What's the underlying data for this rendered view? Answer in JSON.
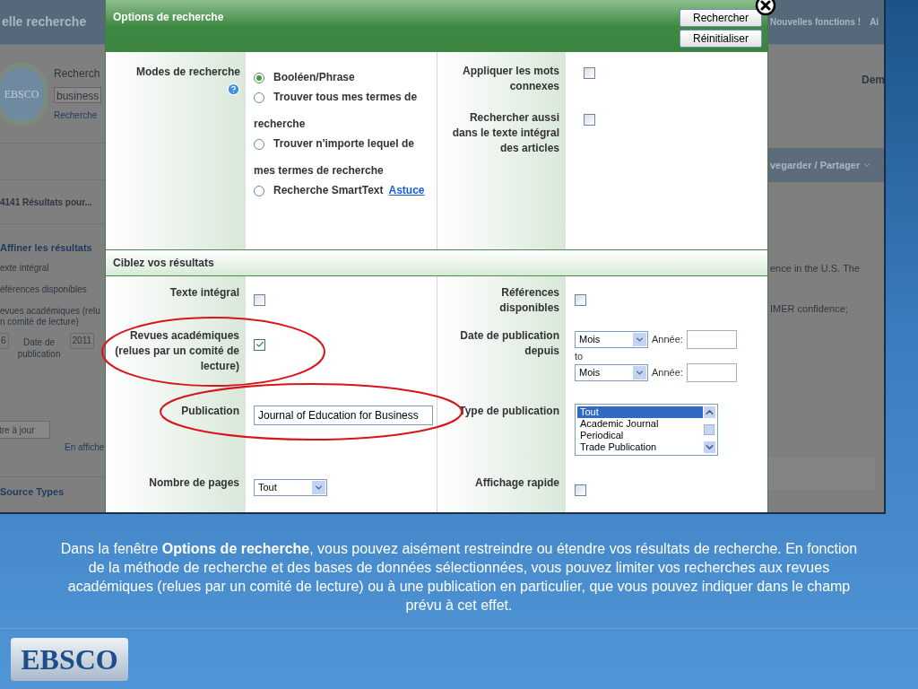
{
  "background_page": {
    "header_title": "elle recherche",
    "header_links": [
      "Nouvelles fonctions !",
      "Ai"
    ],
    "logo": "EBSCO",
    "search_label": "Recherch",
    "search_value": "business",
    "search_link": "Recherche",
    "right_label": "Dem",
    "results_count": "4141 Résultats pour...",
    "refine_title": "Affiner les résultats",
    "refine_lines": [
      "exte intégral",
      "éférences disponibles",
      "evues académiques (relu",
      "n comité de lecture)"
    ],
    "date_from": "6",
    "date_label": "Date de publication",
    "date_to": "2011",
    "update_button": "tre à jour",
    "show_link": "En affiche",
    "source_types": "Source Types",
    "share_menu": "vegarder / Partager",
    "snippets": [
      "ence in the U.S. The",
      "IMER confidence;"
    ]
  },
  "dialog": {
    "title": "Options de recherche",
    "buttons": [
      "Rechercher",
      "Réinitialiser"
    ],
    "search_modes": {
      "label": "Modes de recherche",
      "options": [
        {
          "label": "Booléen/Phrase",
          "selected": true
        },
        {
          "label": "Trouver tous mes termes de recherche",
          "selected": false
        },
        {
          "label": "Trouver n'importe lequel de mes termes de recherche",
          "selected": false
        },
        {
          "label": "Recherche SmartText",
          "selected": false
        }
      ],
      "tip_link": "Astuce"
    },
    "options": [
      {
        "label": "Appliquer les mots connexes",
        "checked": false
      },
      {
        "label": "Rechercher aussi dans le texte intégral des articles",
        "checked": false
      }
    ],
    "section_title": "Ciblez vos résultats",
    "rows": [
      {
        "left": {
          "label": "Texte intégral",
          "kind": "checkbox",
          "checked": false
        },
        "right": {
          "label": "Références disponibles",
          "kind": "checkbox",
          "checked": false
        }
      },
      {
        "left": {
          "label": "Revues académiques (relues par un comité de lecture)",
          "kind": "checkbox",
          "checked": true
        },
        "right": {
          "label": "Date de publication depuis",
          "kind": "date_range",
          "from": {
            "month": "Mois",
            "year_label": "Année:"
          },
          "separator": "to",
          "to": {
            "month": "Mois",
            "year_label": "Année:"
          }
        }
      },
      {
        "left": {
          "label": "Publication",
          "kind": "text",
          "value": "Journal of Education for Business"
        },
        "right": {
          "label": "Type de publication",
          "kind": "listbox",
          "items": [
            {
              "label": "Tout",
              "selected": true
            },
            {
              "label": "Academic Journal",
              "selected": false
            },
            {
              "label": "Periodical",
              "selected": false
            },
            {
              "label": "Trade Publication",
              "selected": false
            }
          ]
        }
      },
      {
        "left": {
          "label": "Nombre de pages",
          "kind": "select",
          "value": "Tout"
        },
        "right": {
          "label": "Affichage rapide",
          "kind": "checkbox",
          "checked": false
        }
      }
    ]
  },
  "caption": "Dans la fenêtre **Options de recherche**, vous pouvez aisément restreindre ou étendre vos résultats de recherche. En fonction de la méthode de recherche et des bases de données sélectionnées, vous pouvez limiter vos recherches aux revues académiques (relues par un comité de lecture) ou à une publication en particulier, que vous pouvez indiquer dans le champ prévu à cet effet.",
  "logo": "EBSCO"
}
